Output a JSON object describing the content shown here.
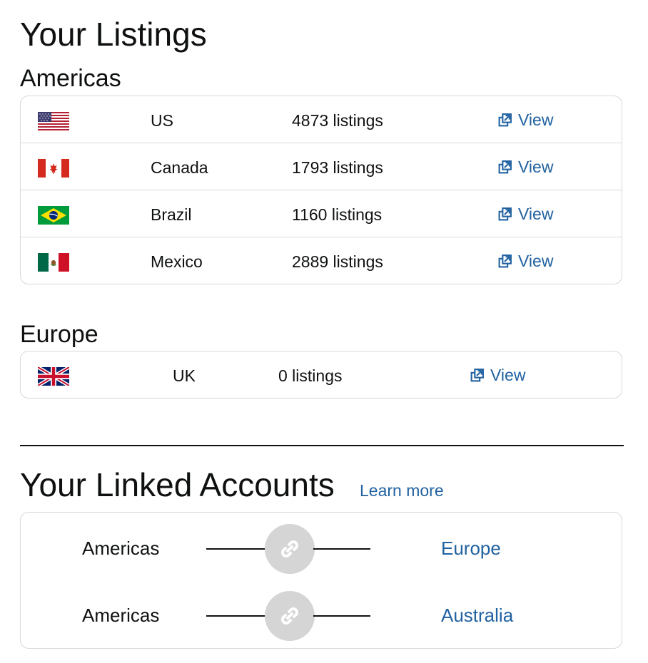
{
  "listings": {
    "title": "Your Listings",
    "regions": [
      {
        "name": "Americas",
        "rows": [
          {
            "flag": "us-flag-icon",
            "country": "US",
            "count": "4873 listings",
            "action": "View"
          },
          {
            "flag": "canada-flag-icon",
            "country": "Canada",
            "count": "1793 listings",
            "action": "View"
          },
          {
            "flag": "brazil-flag-icon",
            "country": "Brazil",
            "count": "1160 listings",
            "action": "View"
          },
          {
            "flag": "mexico-flag-icon",
            "country": "Mexico",
            "count": "2889 listings",
            "action": "View"
          }
        ]
      },
      {
        "name": "Europe",
        "rows": [
          {
            "flag": "uk-flag-icon",
            "country": "UK",
            "count": "0 listings",
            "action": "View"
          }
        ]
      }
    ]
  },
  "linked": {
    "title": "Your Linked Accounts",
    "learn_more": "Learn more",
    "links": [
      {
        "from": "Americas",
        "to": "Europe",
        "icon": "link-icon"
      },
      {
        "from": "Americas",
        "to": "Australia",
        "icon": "link-icon"
      }
    ]
  },
  "colors": {
    "link": "#2162a1",
    "text": "#0f1111",
    "border": "#d5d9d9",
    "link_circle": "#d5d5d5"
  }
}
